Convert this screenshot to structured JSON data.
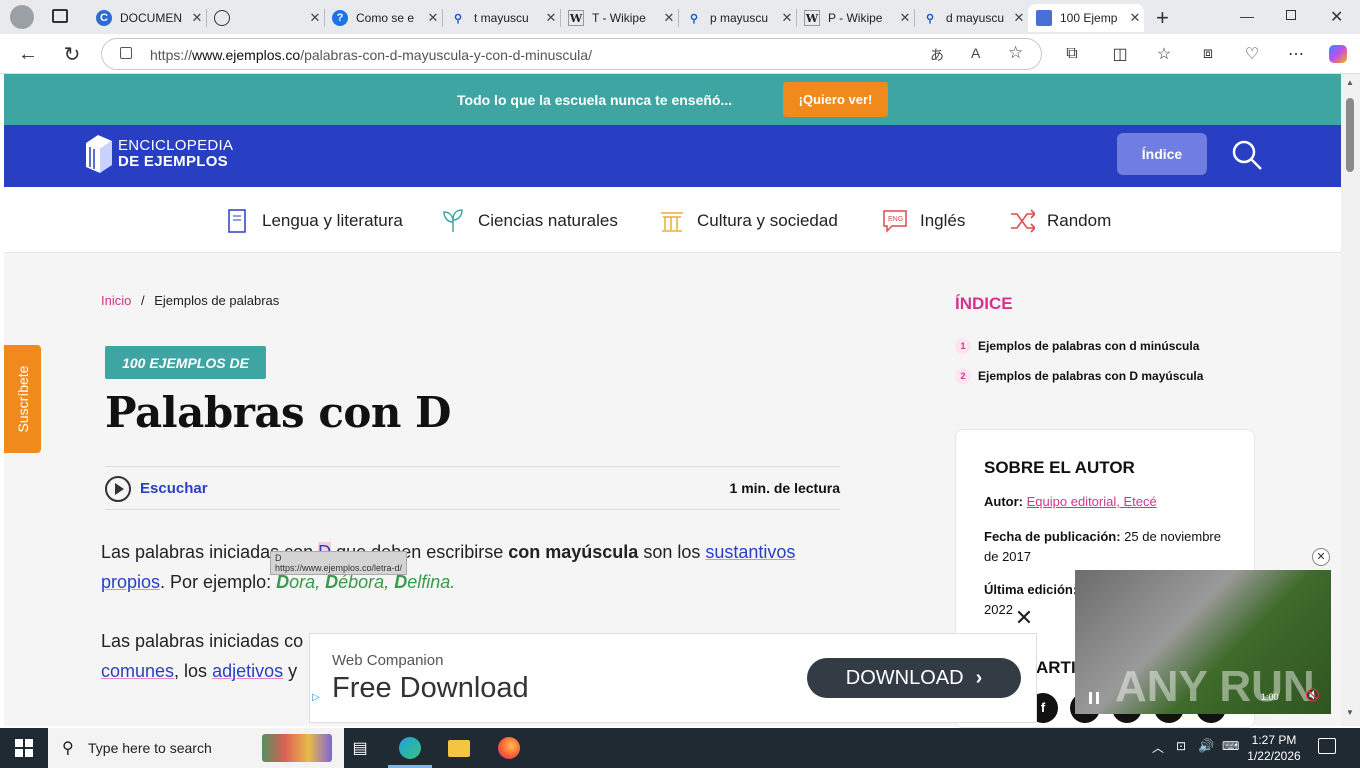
{
  "browser": {
    "tabs": [
      {
        "label": "DOCUMEN",
        "icon": "copilot-c"
      },
      {
        "label": "",
        "icon": "globe"
      },
      {
        "label": "Como se e",
        "icon": "help"
      },
      {
        "label": "t mayuscu",
        "icon": "search"
      },
      {
        "label": "T - Wikipe",
        "icon": "wikipedia"
      },
      {
        "label": "p mayuscu",
        "icon": "search"
      },
      {
        "label": "P - Wikipe",
        "icon": "wikipedia"
      },
      {
        "label": "d mayuscu",
        "icon": "search"
      },
      {
        "label": "100 Ejemp",
        "icon": "ejemplos"
      }
    ],
    "url_prefix": "https://",
    "url_domain": "www.ejemplos.co",
    "url_path": "/palabras-con-d-mayuscula-y-con-d-minuscula/"
  },
  "site": {
    "promo_text": "Todo lo que la escuela nunca te enseñó...",
    "promo_button": "¡Quiero ver!",
    "logo_line1": "ENCICLOPEDIA",
    "logo_line2": "DE EJEMPLOS",
    "indice_button": "Índice",
    "categories": [
      "Lengua y literatura",
      "Ciencias naturales",
      "Cultura y sociedad",
      "Inglés",
      "Random"
    ],
    "suscribete": "Suscríbete"
  },
  "article": {
    "breadcrumb_home": "Inicio",
    "breadcrumb_sep": "/",
    "breadcrumb_current": "Ejemplos de palabras",
    "tag": "100 EJEMPLOS DE",
    "title": "Palabras con D",
    "listen": "Escuchar",
    "read_time": "1 min. de lectura",
    "p1_a": "Las palabras iniciadas con ",
    "p1_d": "D",
    "p1_b": " que deben escribirse ",
    "p1_bold": "con mayúscula",
    "p1_c": " son los ",
    "p1_link": "sustantivos",
    "p1_link2": "propios",
    "p1_d2": ". Por ejemplo: ",
    "ex1_b": "D",
    "ex1_r": "ora, ",
    "ex2_b": "D",
    "ex2_r": "ébora, ",
    "ex3_b": "D",
    "ex3_r": "elfina.",
    "p2_a": "Las palabras iniciadas co",
    "p2_link1": "comunes",
    "p2_b": ", los ",
    "p2_link2": "adjetivos",
    "p2_c": " y",
    "tooltip_title": "D",
    "tooltip_url": "https://www.ejemplos.co/letra-d/"
  },
  "sidebar": {
    "index_heading": "ÍNDICE",
    "index_items": [
      {
        "num": "1",
        "label": "Ejemplos de palabras con d minúscula"
      },
      {
        "num": "2",
        "label": "Ejemplos de palabras con D mayúscula"
      }
    ],
    "author_heading": "SOBRE EL AUTOR",
    "author_label": "Autor:",
    "author_value": "Equipo editorial, Etecé",
    "pub_label": "Fecha de publicación:",
    "pub_value": "25 de noviembre de 2017",
    "edit_label": "Última edición:",
    "edit_value": "2022",
    "share_partial": "ARTI"
  },
  "ad": {
    "subtitle": "Web Companion",
    "title": "Free Download",
    "button": "DOWNLOAD"
  },
  "video": {
    "watermark": "ANY RUN",
    "time": "1:00"
  },
  "taskbar": {
    "search_placeholder": "Type here to search",
    "time": "1:27 PM",
    "date": "1/22/2026"
  }
}
